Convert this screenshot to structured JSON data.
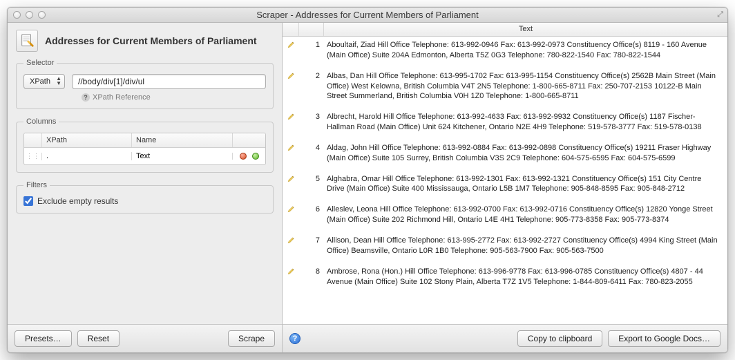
{
  "window": {
    "title": "Scraper - Addresses for Current Members of Parliament"
  },
  "left": {
    "heading": "Addresses for Current Members of Parliament",
    "selector": {
      "legend": "Selector",
      "type_options": [
        "XPath"
      ],
      "type_value": "XPath",
      "expression": "//body/div[1]/div/ul",
      "xpath_reference_label": "XPath Reference"
    },
    "columns": {
      "legend": "Columns",
      "header_xpath": "XPath",
      "header_name": "Name",
      "rows": [
        {
          "xpath": ".",
          "name": "Text"
        }
      ]
    },
    "filters": {
      "legend": "Filters",
      "exclude_empty_label": "Exclude empty results",
      "exclude_empty_checked": true
    },
    "buttons": {
      "presets": "Presets…",
      "reset": "Reset",
      "scrape": "Scrape"
    }
  },
  "right": {
    "header_text": "Text",
    "rows": [
      {
        "n": "1",
        "text": "Aboultaif, Ziad Hill Office Telephone: 613-992-0946 Fax: 613-992-0973 Constituency Office(s) 8119 - 160 Avenue (Main Office) Suite 204A Edmonton, Alberta T5Z 0G3 Telephone: 780-822-1540 Fax: 780-822-1544"
      },
      {
        "n": "2",
        "text": "Albas, Dan Hill Office Telephone: 613-995-1702 Fax: 613-995-1154 Constituency Office(s) 2562B Main Street (Main Office) West Kelowna, British Columbia V4T 2N5 Telephone: 1-800-665-8711 Fax: 250-707-2153 10122-B Main Street Summerland, British Columbia V0H 1Z0 Telephone: 1-800-665-8711"
      },
      {
        "n": "3",
        "text": "Albrecht, Harold Hill Office Telephone: 613-992-4633 Fax: 613-992-9932 Constituency Office(s) 1187 Fischer-Hallman Road (Main Office) Unit 624 Kitchener, Ontario N2E 4H9 Telephone: 519-578-3777 Fax: 519-578-0138"
      },
      {
        "n": "4",
        "text": "Aldag, John Hill Office Telephone: 613-992-0884 Fax: 613-992-0898 Constituency Office(s) 19211 Fraser Highway (Main Office) Suite 105 Surrey, British Columbia V3S 2C9 Telephone: 604-575-6595 Fax: 604-575-6599"
      },
      {
        "n": "5",
        "text": "Alghabra, Omar Hill Office Telephone: 613-992-1301 Fax: 613-992-1321 Constituency Office(s) 151 City Centre Drive (Main Office) Suite 400 Mississauga, Ontario L5B 1M7 Telephone: 905-848-8595 Fax: 905-848-2712"
      },
      {
        "n": "6",
        "text": "Alleslev, Leona Hill Office Telephone: 613-992-0700 Fax: 613-992-0716 Constituency Office(s) 12820 Yonge Street (Main Office) Suite 202 Richmond Hill, Ontario L4E 4H1 Telephone: 905-773-8358 Fax: 905-773-8374"
      },
      {
        "n": "7",
        "text": "Allison, Dean Hill Office Telephone: 613-995-2772 Fax: 613-992-2727 Constituency Office(s) 4994 King Street (Main Office) Beamsville, Ontario L0R 1B0 Telephone: 905-563-7900 Fax: 905-563-7500"
      },
      {
        "n": "8",
        "text": "Ambrose, Rona (Hon.) Hill Office Telephone: 613-996-9778 Fax: 613-996-0785 Constituency Office(s) 4807 - 44 Avenue (Main Office) Suite 102 Stony Plain, Alberta T7Z 1V5 Telephone: 1-844-809-6411 Fax: 780-823-2055"
      }
    ],
    "buttons": {
      "copy": "Copy to clipboard",
      "export": "Export to Google Docs…"
    }
  }
}
